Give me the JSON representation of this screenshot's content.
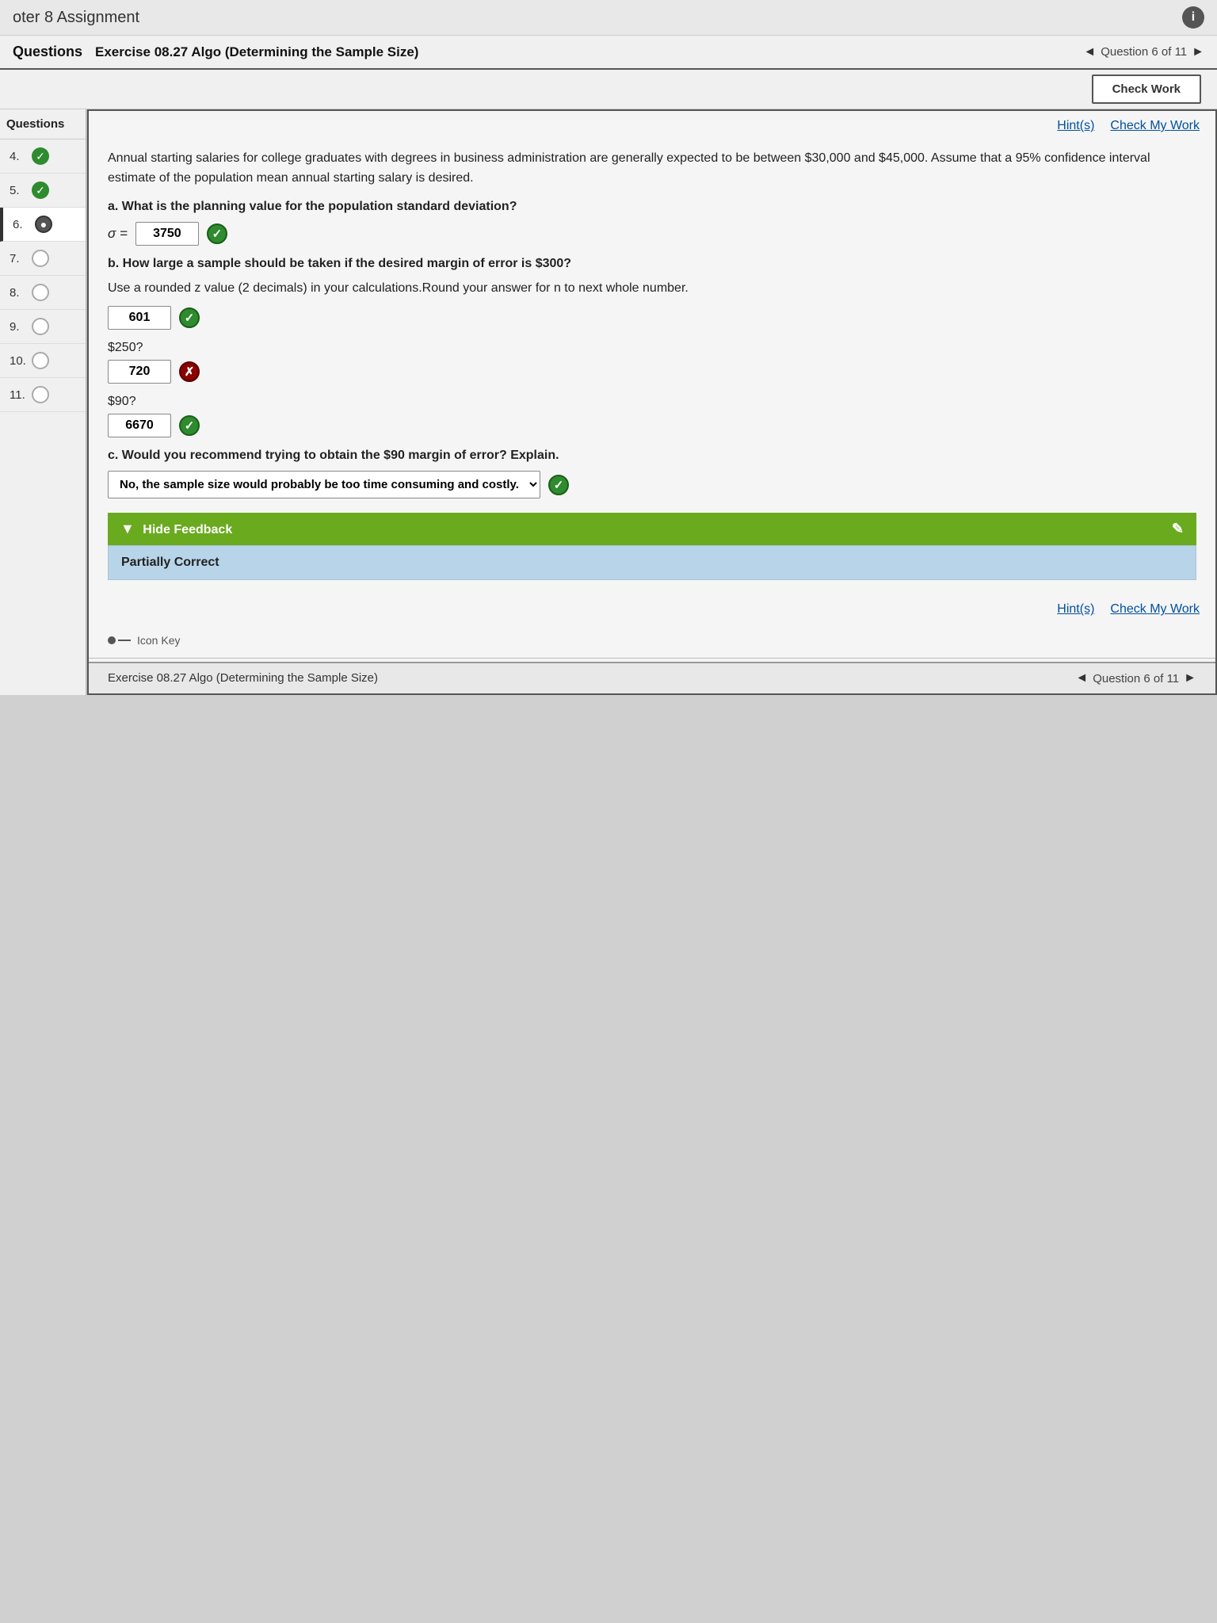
{
  "top_bar": {
    "title": "oter 8 Assignment",
    "info_label": "i"
  },
  "header": {
    "questions_label": "Questions",
    "exercise_title": "Exercise 08.27 Algo (Determining the Sample Size)",
    "question_nav": "◄ Question 6 of 11 ►",
    "question_nav_text": "Question 6 of 11"
  },
  "sidebar": {
    "items": [
      {
        "num": "4.",
        "status": "green-check"
      },
      {
        "num": "5.",
        "status": "green-check"
      },
      {
        "num": "6.",
        "status": "active-dot"
      },
      {
        "num": "7.",
        "status": "empty"
      },
      {
        "num": "8.",
        "status": "empty"
      },
      {
        "num": "9.",
        "status": "empty"
      },
      {
        "num": "10.",
        "status": "empty"
      },
      {
        "num": "11.",
        "status": "empty"
      }
    ]
  },
  "hint_label": "Hint(s)",
  "check_my_work_label": "Check My Work",
  "check_work_label": "Check Work",
  "question": {
    "paragraph": "Annual starting salaries for college graduates with degrees in business administration are generally expected to be between $30,000 and $45,000. Assume that a 95% confidence interval estimate of the population mean annual starting salary is desired.",
    "part_a_label": "a. What is the planning value for the population standard deviation?",
    "sigma_label": "σ =",
    "sigma_answer": "3750",
    "sigma_correct": true,
    "part_b_label": "b. How large a sample should be taken if the desired margin of error is $300?",
    "part_b_sub": "Use a rounded z value (2 decimals) in your calculations.Round your answer for n to next whole number.",
    "margin_300_answer": "601",
    "margin_300_correct": true,
    "margin_250_label": "$250?",
    "margin_250_answer": "720",
    "margin_250_correct": false,
    "margin_90_label": "$90?",
    "margin_90_answer": "6670",
    "margin_90_correct": true,
    "part_c_label": "c. Would you recommend trying to obtain the $90 margin of error? Explain.",
    "part_c_dropdown": "No, the sample size would probably be too time consuming and costly.",
    "part_c_correct": true,
    "feedback_bar_label": "Hide Feedback",
    "partially_correct_label": "Partially Correct",
    "icon_key_label": "Icon Key"
  },
  "footer": {
    "exercise_label": "Exercise 08.27 Algo (Determining the Sample Size)",
    "question_nav": "◄ Question 6 of 11 ►"
  }
}
